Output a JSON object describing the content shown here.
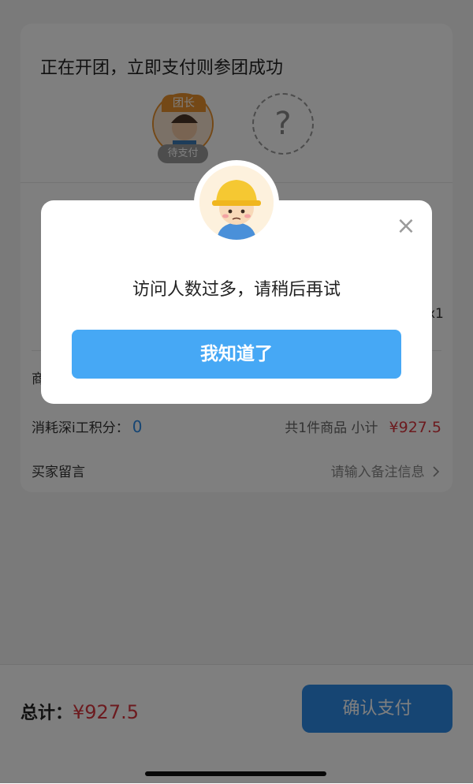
{
  "group": {
    "title": "正在开团，立即支付则参团成功",
    "leader_tag": "团长",
    "pending_tag": "待支付",
    "unknown_member": "?"
  },
  "order": {
    "quantity": "x1",
    "product_row_label_visible": "商",
    "points_label": "消耗深i工积分：",
    "points_value": "0",
    "subtotal_label": "共1件商品  小计",
    "subtotal_price": "¥927.5",
    "message_label": "买家留言",
    "message_placeholder": "请输入备注信息"
  },
  "footer": {
    "total_label": "总计：",
    "total_value": "¥927.5",
    "pay_button": "确认支付"
  },
  "modal": {
    "message": "访问人数过多，请稍后再试",
    "ok_button": "我知道了",
    "close_icon": "×"
  },
  "icons": {
    "chevron": "chevron-right-icon",
    "close": "close-icon",
    "avatar": "worker-mascot-avatar"
  },
  "colors": {
    "accent": "#2d8ae6",
    "price": "#d9363e",
    "leader": "#e8912c",
    "modal_button": "#46a8f5"
  }
}
